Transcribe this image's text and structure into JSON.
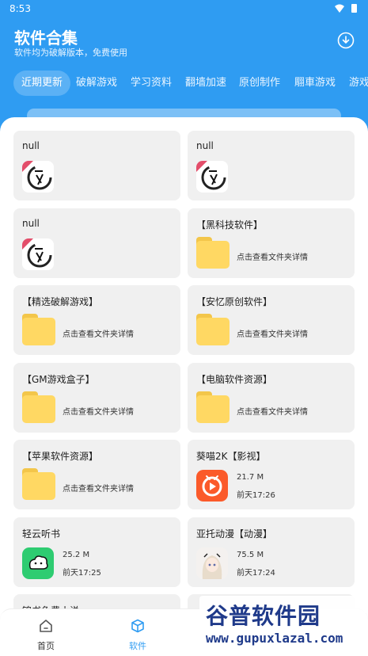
{
  "status_bar": {
    "time": "8:53"
  },
  "header": {
    "title": "软件合集",
    "subtitle": "软件均为破解版本，免费使用",
    "download_icon": "download-circle-icon"
  },
  "tabs": [
    {
      "label": "近期更新",
      "active": true
    },
    {
      "label": "破解游戏",
      "active": false
    },
    {
      "label": "学习资料",
      "active": false
    },
    {
      "label": "翻墙加速",
      "active": false
    },
    {
      "label": "原创制作",
      "active": false
    },
    {
      "label": "翢車游戏",
      "active": false
    },
    {
      "label": "游戏",
      "active": false
    }
  ],
  "items": [
    {
      "title": "null",
      "icon": "brand-logo-icon"
    },
    {
      "title": "null",
      "icon": "brand-logo-icon"
    },
    {
      "title": "null",
      "icon": "brand-logo-icon"
    },
    {
      "title": "【黑科技软件】",
      "icon": "folder-icon",
      "info": "点击查看文件夹详情"
    },
    {
      "title": "【精选破解游戏】",
      "icon": "folder-icon",
      "info": "点击查看文件夹详情"
    },
    {
      "title": "【安忆原创软件】",
      "icon": "folder-icon",
      "info": "点击查看文件夹详情"
    },
    {
      "title": "【GM游戏盒子】",
      "icon": "folder-icon",
      "info": "点击查看文件夹详情"
    },
    {
      "title": "【电脑软件资源】",
      "icon": "folder-icon",
      "info": "点击查看文件夹详情"
    },
    {
      "title": "【苹果软件资源】",
      "icon": "folder-icon",
      "info": "点击查看文件夹详情"
    },
    {
      "title": "葵喵2K【影视】",
      "icon": "video-app-icon",
      "size": "21.7 M",
      "time": "前天17:26"
    },
    {
      "title": "轻云听书",
      "icon": "audiobook-app-icon",
      "size": "25.2 M",
      "time": "前天17:25"
    },
    {
      "title": "亚托动漫【动漫】",
      "icon": "anime-app-icon",
      "size": "75.5 M",
      "time": "前天17:24"
    },
    {
      "title": "锦书免费小说"
    },
    {
      "title": ""
    }
  ],
  "bottom_nav": [
    {
      "label": "首页",
      "icon": "home-icon",
      "active": false
    },
    {
      "label": "软件",
      "icon": "cube-icon",
      "active": true
    }
  ],
  "watermark": {
    "title": "谷普软件园",
    "url": "www.gupuxlazal.com"
  },
  "colors": {
    "primary": "#2f9cf2",
    "active_nav": "#2f9cf2",
    "card_bg": "#f0f0f0",
    "folder": "#ffd863"
  }
}
